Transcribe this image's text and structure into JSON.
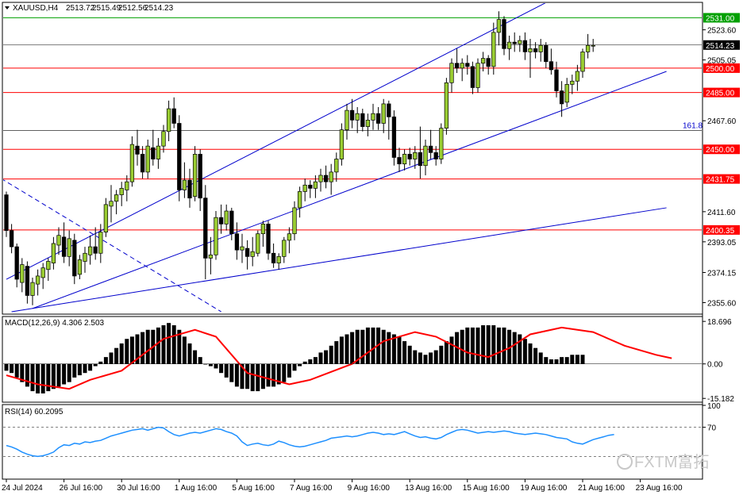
{
  "chart_data": {
    "type": "candlestick",
    "symbol_label": "XAUUSD,H4",
    "ohlc_header": [
      "2513.72",
      "2515.49",
      "2512.56",
      "2514.23"
    ],
    "price_axis": {
      "ylim": [
        2349,
        2540
      ],
      "ticks": [
        "2523.60",
        "2505.05",
        "2467.60",
        "2411.60",
        "2393.05",
        "2374.15",
        "2355.60"
      ]
    },
    "horizontal_levels": [
      {
        "value": 2531.0,
        "label": "2531.00",
        "color": "#00a000"
      },
      {
        "value": 2500.0,
        "label": "2500.00",
        "color": "#ff0000"
      },
      {
        "value": 2485.0,
        "label": "2485.00",
        "color": "#ff0000"
      },
      {
        "value": 2450.0,
        "label": "2450.00",
        "color": "#ff0000"
      },
      {
        "value": 2431.75,
        "label": "2431.75",
        "color": "#ff0000"
      },
      {
        "value": 2400.35,
        "label": "2400.35",
        "color": "#ff0000"
      }
    ],
    "current_price": {
      "value": 2514.23,
      "label": "2514.23"
    },
    "fib_line": {
      "value": 2461.5,
      "label": "161.8"
    },
    "candles": [
      [
        2422,
        2424,
        2396,
        2400
      ],
      [
        2400,
        2404,
        2386,
        2390
      ],
      [
        2390,
        2392,
        2365,
        2370
      ],
      [
        2368,
        2383,
        2362,
        2379
      ],
      [
        2378,
        2381,
        2355,
        2360
      ],
      [
        2360,
        2371,
        2354,
        2368
      ],
      [
        2367,
        2376,
        2360,
        2372
      ],
      [
        2371,
        2380,
        2364,
        2377
      ],
      [
        2376,
        2383,
        2369,
        2381
      ],
      [
        2380,
        2396,
        2376,
        2392
      ],
      [
        2391,
        2402,
        2385,
        2397
      ],
      [
        2396,
        2405,
        2380,
        2384
      ],
      [
        2384,
        2400,
        2378,
        2395
      ],
      [
        2394,
        2398,
        2367,
        2372
      ],
      [
        2373,
        2385,
        2370,
        2382
      ],
      [
        2381,
        2390,
        2374,
        2386
      ],
      [
        2385,
        2397,
        2379,
        2390
      ],
      [
        2390,
        2402,
        2382,
        2386
      ],
      [
        2386,
        2404,
        2380,
        2399
      ],
      [
        2399,
        2420,
        2396,
        2416
      ],
      [
        2415,
        2428,
        2405,
        2418
      ],
      [
        2418,
        2425,
        2410,
        2422
      ],
      [
        2422,
        2430,
        2415,
        2426
      ],
      [
        2425,
        2434,
        2418,
        2430
      ],
      [
        2430,
        2458,
        2427,
        2453
      ],
      [
        2452,
        2462,
        2440,
        2447
      ],
      [
        2447,
        2452,
        2432,
        2436
      ],
      [
        2436,
        2456,
        2432,
        2452
      ],
      [
        2451,
        2462,
        2440,
        2444
      ],
      [
        2444,
        2457,
        2438,
        2452
      ],
      [
        2452,
        2465,
        2448,
        2461
      ],
      [
        2461,
        2480,
        2455,
        2475
      ],
      [
        2475,
        2482,
        2463,
        2466
      ],
      [
        2466,
        2471,
        2418,
        2425
      ],
      [
        2425,
        2442,
        2420,
        2431
      ],
      [
        2431,
        2438,
        2414,
        2420
      ],
      [
        2421,
        2452,
        2418,
        2447
      ],
      [
        2447,
        2450,
        2412,
        2420
      ],
      [
        2420,
        2428,
        2370,
        2383
      ],
      [
        2383,
        2396,
        2373,
        2385
      ],
      [
        2385,
        2412,
        2382,
        2408
      ],
      [
        2408,
        2416,
        2398,
        2404
      ],
      [
        2404,
        2416,
        2400,
        2412
      ],
      [
        2412,
        2414,
        2394,
        2398
      ],
      [
        2398,
        2405,
        2382,
        2388
      ],
      [
        2388,
        2398,
        2380,
        2390
      ],
      [
        2389,
        2394,
        2376,
        2384
      ],
      [
        2384,
        2396,
        2378,
        2387
      ],
      [
        2386,
        2400,
        2384,
        2398
      ],
      [
        2398,
        2406,
        2390,
        2404
      ],
      [
        2404,
        2406,
        2382,
        2386
      ],
      [
        2386,
        2392,
        2377,
        2380
      ],
      [
        2380,
        2386,
        2376,
        2384
      ],
      [
        2384,
        2396,
        2380,
        2394
      ],
      [
        2394,
        2402,
        2386,
        2398
      ],
      [
        2398,
        2418,
        2394,
        2414
      ],
      [
        2414,
        2427,
        2408,
        2424
      ],
      [
        2424,
        2432,
        2418,
        2428
      ],
      [
        2428,
        2431,
        2420,
        2426
      ],
      [
        2426,
        2434,
        2420,
        2430
      ],
      [
        2430,
        2438,
        2424,
        2434
      ],
      [
        2434,
        2440,
        2426,
        2430
      ],
      [
        2430,
        2441,
        2422,
        2436
      ],
      [
        2436,
        2448,
        2430,
        2444
      ],
      [
        2444,
        2466,
        2440,
        2462
      ],
      [
        2462,
        2478,
        2456,
        2474
      ],
      [
        2474,
        2481,
        2463,
        2468
      ],
      [
        2468,
        2476,
        2460,
        2472
      ],
      [
        2472,
        2475,
        2461,
        2464
      ],
      [
        2464,
        2472,
        2458,
        2468
      ],
      [
        2468,
        2478,
        2462,
        2472
      ],
      [
        2472,
        2476,
        2462,
        2466
      ],
      [
        2466,
        2481,
        2460,
        2478
      ],
      [
        2478,
        2480,
        2456,
        2470
      ],
      [
        2470,
        2474,
        2440,
        2445
      ],
      [
        2445,
        2451,
        2436,
        2441
      ],
      [
        2441,
        2450,
        2437,
        2447
      ],
      [
        2447,
        2451,
        2440,
        2444
      ],
      [
        2444,
        2452,
        2438,
        2448
      ],
      [
        2448,
        2464,
        2432,
        2440
      ],
      [
        2440,
        2456,
        2434,
        2452
      ],
      [
        2452,
        2462,
        2444,
        2448
      ],
      [
        2448,
        2452,
        2440,
        2444
      ],
      [
        2444,
        2466,
        2441,
        2463
      ],
      [
        2463,
        2494,
        2459,
        2491
      ],
      [
        2491,
        2506,
        2485,
        2503
      ],
      [
        2503,
        2512,
        2497,
        2500
      ],
      [
        2500,
        2506,
        2492,
        2503
      ],
      [
        2503,
        2508,
        2496,
        2501
      ],
      [
        2501,
        2504,
        2484,
        2488
      ],
      [
        2488,
        2506,
        2485,
        2503
      ],
      [
        2503,
        2510,
        2498,
        2506
      ],
      [
        2506,
        2508,
        2496,
        2501
      ],
      [
        2501,
        2528,
        2496,
        2522
      ],
      [
        2522,
        2535,
        2514,
        2530
      ],
      [
        2530,
        2532,
        2508,
        2512
      ],
      [
        2512,
        2520,
        2505,
        2516
      ],
      [
        2516,
        2522,
        2510,
        2515
      ],
      [
        2515,
        2520,
        2510,
        2517
      ],
      [
        2517,
        2522,
        2505,
        2510
      ],
      [
        2510,
        2518,
        2494,
        2512
      ],
      [
        2512,
        2516,
        2506,
        2510
      ],
      [
        2510,
        2518,
        2504,
        2514
      ],
      [
        2514,
        2516,
        2500,
        2504
      ],
      [
        2504,
        2512,
        2496,
        2499
      ],
      [
        2499,
        2504,
        2482,
        2486
      ],
      [
        2486,
        2492,
        2470,
        2478
      ],
      [
        2479,
        2494,
        2476,
        2490
      ],
      [
        2490,
        2496,
        2484,
        2492
      ],
      [
        2492,
        2502,
        2486,
        2498
      ],
      [
        2498,
        2512,
        2494,
        2510
      ],
      [
        2510,
        2521,
        2506,
        2514
      ],
      [
        2514,
        2518,
        2510,
        2514
      ]
    ],
    "channel_lines": [
      {
        "p1": [
          0,
          2370
        ],
        "p2": [
          104,
          2542
        ],
        "color": "#0000cc",
        "dash": false
      },
      {
        "p1": [
          5,
          2352
        ],
        "p2": [
          126,
          2498
        ],
        "color": "#0000cc",
        "dash": false
      },
      {
        "p1": [
          1,
          2350
        ],
        "p2": [
          126,
          2414
        ],
        "color": "#0000cc",
        "dash": false
      },
      {
        "p1": [
          -1,
          2432
        ],
        "p2": [
          41,
          2350
        ],
        "color": "#0000cc",
        "dash": true
      }
    ],
    "macd": {
      "label": "MACD(12,26,9) 4.306 2.503",
      "ylim": [
        -16.5,
        20.5
      ],
      "ticks": [
        "18.696",
        "0.00",
        "-15.182"
      ],
      "histogram": [
        -3,
        -4,
        -6,
        -8,
        -10,
        -12,
        -13,
        -13,
        -12,
        -11,
        -10,
        -9,
        -8,
        -6,
        -5,
        -4,
        -3,
        -1,
        1,
        3,
        5,
        7,
        9,
        11,
        12,
        13,
        14,
        15,
        15,
        16,
        17,
        18,
        17,
        15,
        12,
        9,
        6,
        3,
        0,
        -1,
        -2,
        -4,
        -6,
        -8,
        -10,
        -11,
        -11,
        -12,
        -12,
        -11,
        -10,
        -10,
        -9,
        -8,
        -6,
        -3,
        -1,
        1,
        2,
        3,
        5,
        6,
        8,
        10,
        12,
        13,
        14,
        15,
        15,
        16,
        16,
        16,
        15,
        14,
        13,
        12,
        10,
        8,
        6,
        5,
        4,
        5,
        6,
        8,
        10,
        12,
        14,
        15,
        16,
        16,
        16,
        17,
        17,
        17,
        16,
        16,
        15,
        14,
        13,
        11,
        9,
        7,
        5,
        3,
        2,
        2,
        3,
        3,
        4,
        4,
        4
      ],
      "signal_points": [
        [
          0,
          -5
        ],
        [
          6,
          -9
        ],
        [
          12,
          -11
        ],
        [
          16,
          -7
        ],
        [
          22,
          -3
        ],
        [
          30,
          11
        ],
        [
          36,
          15
        ],
        [
          40,
          12
        ],
        [
          46,
          -4
        ],
        [
          54,
          -9
        ],
        [
          58,
          -7
        ],
        [
          66,
          0
        ],
        [
          72,
          10
        ],
        [
          78,
          14
        ],
        [
          82,
          12
        ],
        [
          88,
          5
        ],
        [
          92,
          3
        ],
        [
          96,
          7
        ],
        [
          100,
          13
        ],
        [
          106,
          16
        ],
        [
          112,
          14
        ],
        [
          118,
          8
        ],
        [
          124,
          4
        ],
        [
          127,
          2.5
        ]
      ]
    },
    "rsi": {
      "label": "RSI(14) 60.2095",
      "ylim": [
        0,
        100
      ],
      "ticks": [
        "100",
        "70"
      ],
      "values": [
        45,
        43,
        40,
        36,
        33,
        31,
        30,
        31,
        33,
        36,
        42,
        46,
        45,
        48,
        47,
        50,
        49,
        51,
        52,
        55,
        58,
        60,
        62,
        64,
        66,
        67,
        68,
        66,
        68,
        70,
        69,
        64,
        60,
        58,
        60,
        62,
        63,
        62,
        64,
        66,
        68,
        67,
        64,
        62,
        58,
        50,
        45,
        47,
        48,
        46,
        45,
        47,
        51,
        49,
        46,
        44,
        43,
        44,
        46,
        48,
        50,
        52,
        55,
        56,
        57,
        58,
        57,
        58,
        60,
        62,
        63,
        62,
        60,
        61,
        60,
        62,
        64,
        61,
        58,
        56,
        57,
        55,
        54,
        56,
        60,
        63,
        66,
        67,
        66,
        64,
        62,
        63,
        64,
        63,
        64,
        65,
        64,
        62,
        61,
        60,
        61,
        62,
        61,
        60,
        58,
        56,
        55,
        54,
        50,
        48,
        47,
        50,
        53,
        55,
        57,
        59,
        60
      ]
    },
    "x_axis": {
      "tick_labels": [
        "24 Jul 2024",
        "26 Jul 16:00",
        "30 Jul 16:00",
        "1 Aug 16:00",
        "5 Aug 16:00",
        "7 Aug 16:00",
        "9 Aug 16:00",
        "13 Aug 16:00",
        "15 Aug 16:00",
        "19 Aug 16:00",
        "21 Aug 16:00",
        "23 Aug 16:00"
      ],
      "tick_candle_index": [
        0,
        11,
        22,
        33,
        44,
        55,
        66,
        77,
        88,
        99,
        110,
        121
      ]
    },
    "watermark": "FXTM富拓"
  }
}
